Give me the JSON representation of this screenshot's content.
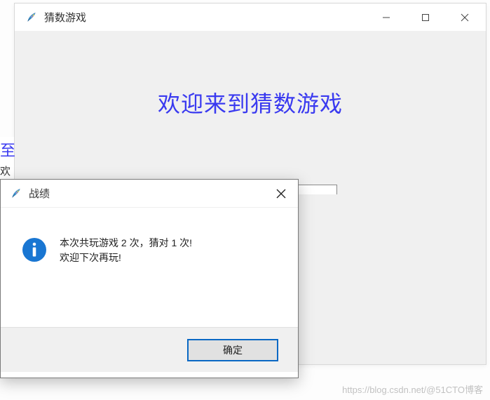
{
  "main_window": {
    "title": "猜数游戏",
    "welcome_text": "欢迎来到猜数游戏",
    "left_peek_line1": "至",
    "left_peek_line2": "欢"
  },
  "dialog": {
    "title": "战绩",
    "message_line1": "本次共玩游戏 2 次，猜对 1 次!",
    "message_line2": "欢迎下次再玩!",
    "ok_label": "确定"
  },
  "watermark": "https://blog.csdn.net/@51CTO博客"
}
